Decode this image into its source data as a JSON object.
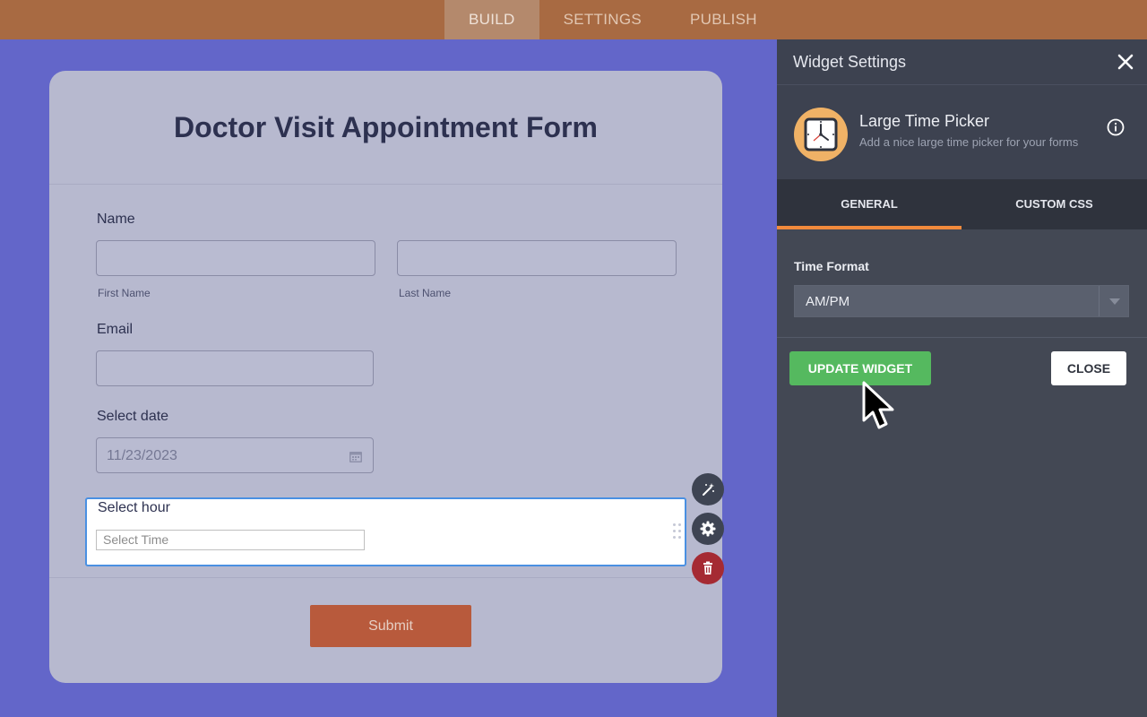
{
  "nav": {
    "tabs": [
      {
        "label": "BUILD",
        "active": true
      },
      {
        "label": "SETTINGS",
        "active": false
      },
      {
        "label": "PUBLISH",
        "active": false
      }
    ]
  },
  "form": {
    "title": "Doctor Visit Appointment Form",
    "name_label": "Name",
    "first_name_sublabel": "First Name",
    "last_name_sublabel": "Last Name",
    "email_label": "Email",
    "date_label": "Select date",
    "date_value": "11/23/2023",
    "hour_label": "Select hour",
    "hour_placeholder": "Select Time",
    "submit_label": "Submit"
  },
  "panel": {
    "title": "Widget Settings",
    "widget": {
      "name": "Large Time Picker",
      "description": "Add a nice large time picker for your forms",
      "icon": "clock-icon"
    },
    "tabs": [
      {
        "label": "GENERAL",
        "active": true
      },
      {
        "label": "CUSTOM CSS",
        "active": false
      }
    ],
    "time_format": {
      "label": "Time Format",
      "value": "AM/PM"
    },
    "update_button": "UPDATE WIDGET",
    "close_button": "CLOSE"
  },
  "colors": {
    "canvas_bg": "#6366c9",
    "topbar": "#a86a42",
    "accent_orange": "#f28a3c",
    "update_green": "#55b95f",
    "selected_border": "#4a90e2",
    "delete_red": "#a52a33"
  }
}
